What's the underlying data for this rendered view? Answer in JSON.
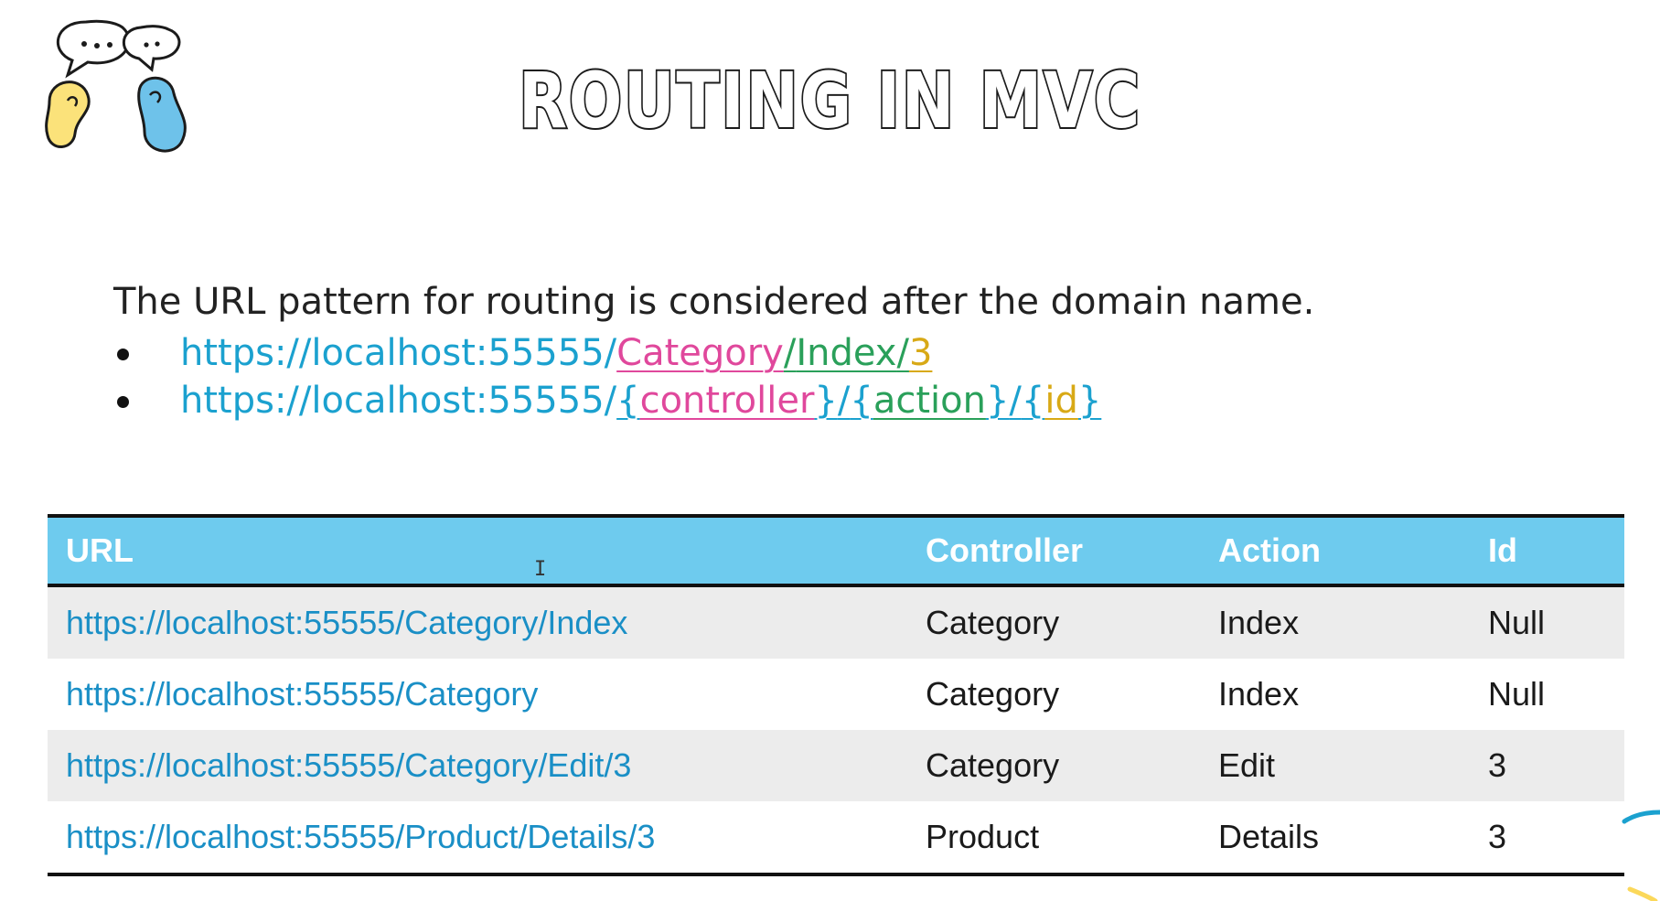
{
  "title": "ROUTING IN MVC",
  "intro": "The URL pattern for routing is considered after the domain name.",
  "bullets": [
    {
      "base": "https://localhost:55555/",
      "controller": "Category",
      "sep1": "/",
      "action": "Index",
      "sep2": "/",
      "id": "3"
    },
    {
      "base": "https://localhost:55555/",
      "controller_open": "{",
      "controller": "controller",
      "controller_close": "}",
      "sep1": "/",
      "action_open": "{",
      "action": "action",
      "action_close": "}",
      "sep2": "/",
      "id_open": "{",
      "id": "id",
      "id_close": "}"
    }
  ],
  "table": {
    "headers": [
      "URL",
      "Controller",
      "Action",
      "Id"
    ],
    "rows": [
      [
        "https://localhost:55555/Category/Index",
        "Category",
        "Index",
        "Null"
      ],
      [
        "https://localhost:55555/Category",
        "Category",
        "Index",
        "Null"
      ],
      [
        "https://localhost:55555/Category/Edit/3",
        "Category",
        "Edit",
        "3"
      ],
      [
        "https://localhost:55555/Product/Details/3",
        "Product",
        "Details",
        "3"
      ]
    ]
  },
  "colors": {
    "base_url": "#1ba1cf",
    "controller": "#e0489c",
    "action": "#2aa05a",
    "id": "#d8a916",
    "header_bg": "#6ecbee"
  },
  "cursor_glyph": "I"
}
